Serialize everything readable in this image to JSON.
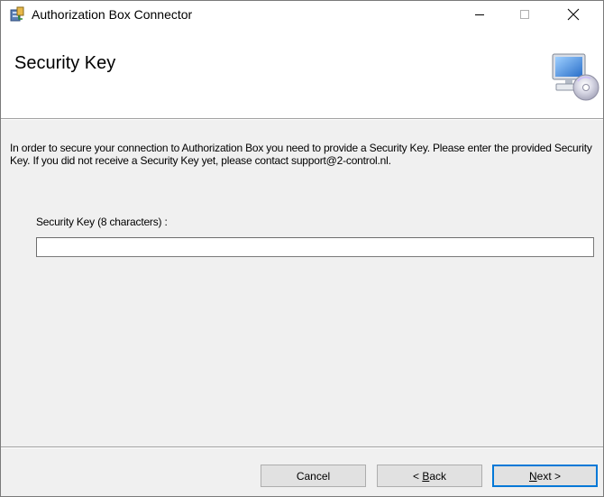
{
  "window": {
    "title": "Authorization Box Connector",
    "controls": {
      "minimize_icon": "minimize-icon",
      "maximize_icon": "maximize-icon",
      "close_icon": "close-icon"
    }
  },
  "banner": {
    "title": "Security Key",
    "image": "computer-disc-icon"
  },
  "content": {
    "description": "In order to secure your connection to Authorization Box you need to provide a Security Key. Please enter the provided Security Key. If you did not receive a Security Key yet, please contact support@2-control.nl.",
    "field_label": "Security Key (8 characters) :",
    "field_value": ""
  },
  "buttons": {
    "cancel": "Cancel",
    "back": {
      "prefix": "< ",
      "mnemonic": "B",
      "rest": "ack"
    },
    "next": {
      "mnemonic": "N",
      "rest": "ext >"
    }
  },
  "colors": {
    "focus_border": "#0078d7",
    "button_face": "#e1e1e1",
    "dialog_background": "#f0f0f0"
  }
}
